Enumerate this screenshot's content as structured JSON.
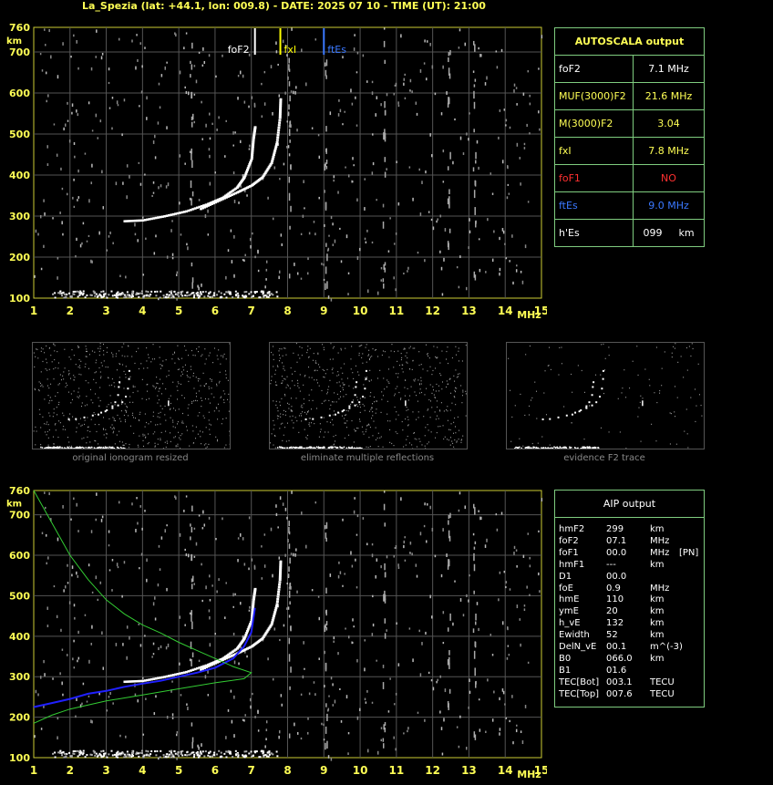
{
  "header": {
    "title": "La_Spezia (lat: +44.1, lon: 009.8) - DATE: 2025 07 10 - TIME (UT): 21:00"
  },
  "chart_data": [
    {
      "type": "scatter",
      "name": "ionogram-autoscala",
      "xlabel": "MHz",
      "ylabel": "km",
      "xlim": [
        1,
        15
      ],
      "ylim": [
        100,
        760
      ],
      "x_ticks": [
        "1",
        "2",
        "3",
        "4",
        "5",
        "6",
        "7",
        "8",
        "9",
        "10",
        "11",
        "12",
        "13",
        "14",
        "15"
      ],
      "y_ticks": [
        "100",
        "200",
        "300",
        "400",
        "500",
        "600",
        "700",
        "760"
      ],
      "markers": [
        {
          "label": "foF2",
          "x": 7.1,
          "color": "#ffffff"
        },
        {
          "label": "fxI",
          "x": 7.8,
          "color": "#ffff00"
        },
        {
          "label": "ftEs",
          "x": 9.0,
          "color": "#3a78ff"
        }
      ],
      "o_trace": [
        [
          3.5,
          288
        ],
        [
          4.0,
          290
        ],
        [
          4.6,
          300
        ],
        [
          5.2,
          312
        ],
        [
          5.8,
          330
        ],
        [
          6.2,
          345
        ],
        [
          6.6,
          370
        ],
        [
          6.8,
          395
        ],
        [
          7.0,
          440
        ],
        [
          7.05,
          490
        ],
        [
          7.1,
          520
        ]
      ],
      "x_trace": [
        [
          5.6,
          318
        ],
        [
          6.1,
          338
        ],
        [
          6.6,
          358
        ],
        [
          7.0,
          375
        ],
        [
          7.3,
          395
        ],
        [
          7.55,
          430
        ],
        [
          7.7,
          480
        ],
        [
          7.78,
          540
        ],
        [
          7.8,
          590
        ]
      ],
      "grid": true
    },
    {
      "type": "line",
      "name": "ionogram-aip",
      "xlabel": "MHz",
      "ylabel": "km",
      "xlim": [
        1,
        15
      ],
      "ylim": [
        100,
        760
      ],
      "x_ticks": [
        "1",
        "2",
        "3",
        "4",
        "5",
        "6",
        "7",
        "8",
        "9",
        "10",
        "11",
        "12",
        "13",
        "14",
        "15"
      ],
      "y_ticks": [
        "100",
        "200",
        "300",
        "400",
        "500",
        "600",
        "700",
        "760"
      ],
      "series": [
        {
          "name": "",
          "color": "#2020ff",
          "points": [
            [
              1.0,
              225
            ],
            [
              1.5,
              235
            ],
            [
              2.0,
              245
            ],
            [
              2.5,
              258
            ],
            [
              3.0,
              265
            ],
            [
              3.5,
              275
            ],
            [
              4.0,
              283
            ],
            [
              4.5,
              290
            ],
            [
              5.0,
              300
            ],
            [
              5.5,
              310
            ],
            [
              6.0,
              322
            ],
            [
              6.5,
              345
            ],
            [
              6.8,
              375
            ],
            [
              7.0,
              410
            ],
            [
              7.1,
              470
            ]
          ]
        },
        {
          "name": "",
          "color": "#33cc33",
          "points": [
            [
              1.0,
              760
            ],
            [
              1.5,
              680
            ],
            [
              2.0,
              600
            ],
            [
              2.5,
              540
            ],
            [
              3.0,
              490
            ],
            [
              3.5,
              455
            ],
            [
              4.0,
              428
            ],
            [
              4.5,
              408
            ],
            [
              5.0,
              385
            ],
            [
              5.5,
              365
            ],
            [
              6.0,
              345
            ],
            [
              6.5,
              325
            ],
            [
              7.0,
              310
            ],
            [
              6.8,
              295
            ],
            [
              6.0,
              285
            ],
            [
              5.0,
              270
            ],
            [
              4.0,
              255
            ],
            [
              3.0,
              240
            ],
            [
              2.0,
              220
            ],
            [
              1.5,
              205
            ],
            [
              1.0,
              185
            ]
          ]
        }
      ],
      "grid": true
    }
  ],
  "autoscala": {
    "title": "AUTOSCALA output",
    "rows": [
      {
        "label": "foF2",
        "value": "7.1 MHz",
        "label_color": "#ffffff",
        "value_color": "#ffffff"
      },
      {
        "label": "MUF(3000)F2",
        "value": "21.6 MHz",
        "label_color": "#ffff55",
        "value_color": "#ffff55"
      },
      {
        "label": "M(3000)F2",
        "value": "3.04",
        "label_color": "#ffff55",
        "value_color": "#ffff55"
      },
      {
        "label": "fxI",
        "value": "7.8 MHz",
        "label_color": "#ffff55",
        "value_color": "#ffff55"
      },
      {
        "label": "foF1",
        "value": "NO",
        "label_color": "#ff3030",
        "value_color": "#ff3030"
      },
      {
        "label": "ftEs",
        "value": "9.0 MHz",
        "label_color": "#3a78ff",
        "value_color": "#3a78ff"
      },
      {
        "label": "h'Es",
        "value": "099",
        "unit": "km",
        "label_color": "#ffffff",
        "value_color": "#ffffff"
      }
    ]
  },
  "thumbnails": [
    {
      "caption": "original ionogram resized"
    },
    {
      "caption": "eliminate multiple reflections"
    },
    {
      "caption": "evidence F2 trace"
    }
  ],
  "aip": {
    "title": "AIP output",
    "rows": [
      {
        "label": "hmF2",
        "value": "299",
        "unit": "km",
        "extra": ""
      },
      {
        "label": "foF2",
        "value": "07.1",
        "unit": "MHz",
        "extra": ""
      },
      {
        "label": "foF1",
        "value": "00.0",
        "unit": "MHz",
        "extra": "[PN]"
      },
      {
        "label": "hmF1",
        "value": "---",
        "unit": "km",
        "extra": ""
      },
      {
        "label": "D1",
        "value": "00.0",
        "unit": "",
        "extra": ""
      },
      {
        "label": "foE",
        "value": "0.9",
        "unit": "MHz",
        "extra": ""
      },
      {
        "label": "hmE",
        "value": "110",
        "unit": "km",
        "extra": ""
      },
      {
        "label": "ymE",
        "value": "20",
        "unit": "km",
        "extra": ""
      },
      {
        "label": "h_vE",
        "value": "132",
        "unit": "km",
        "extra": ""
      },
      {
        "label": "Ewidth",
        "value": "52",
        "unit": "km",
        "extra": ""
      },
      {
        "label": "DelN_vE",
        "value": "00.1",
        "unit": "m^(-3)",
        "extra": ""
      },
      {
        "label": "B0",
        "value": "066.0",
        "unit": "km",
        "extra": ""
      },
      {
        "label": "B1",
        "value": "01.6",
        "unit": "",
        "extra": ""
      },
      {
        "label": "TEC[Bot]",
        "value": "003.1",
        "unit": "TECU",
        "extra": ""
      },
      {
        "label": "TEC[Top]",
        "value": "007.6",
        "unit": "TECU",
        "extra": ""
      }
    ]
  }
}
